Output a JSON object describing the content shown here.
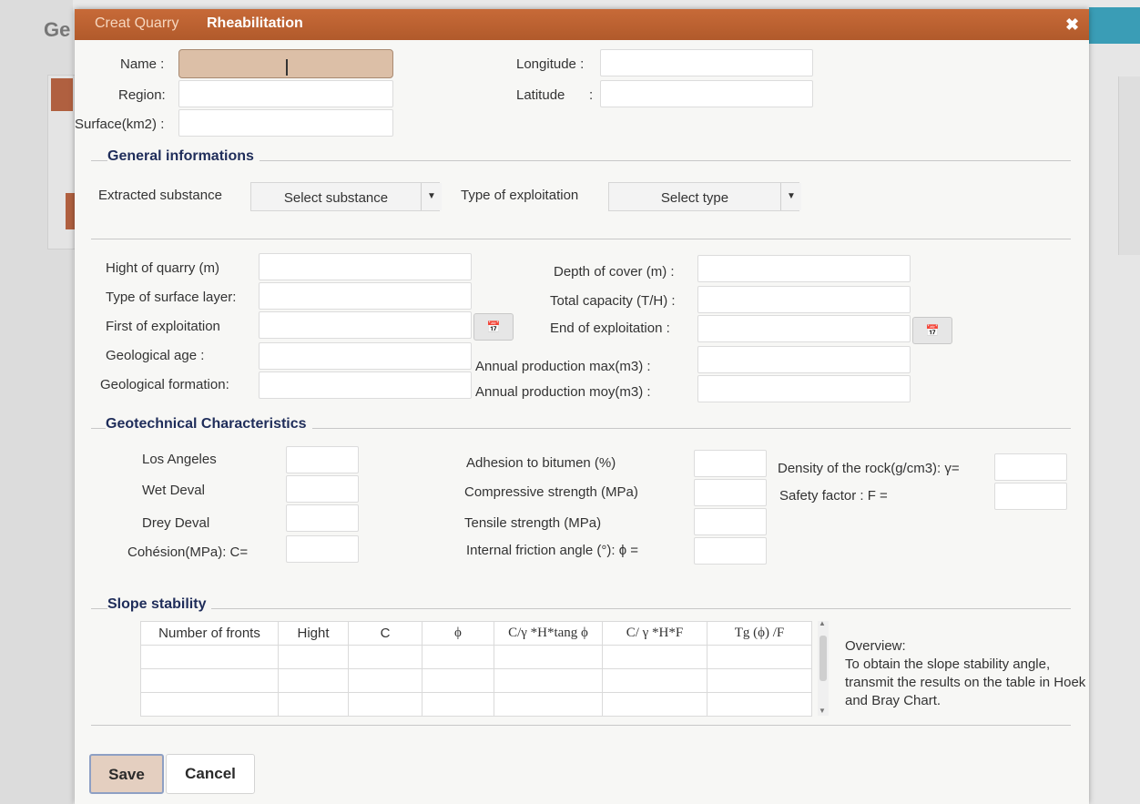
{
  "background": {
    "title": "Ge"
  },
  "dialog": {
    "tabs": {
      "creat": "Creat Quarry",
      "rheabilitation": "Rheabilitation"
    },
    "close_icon": "✖"
  },
  "identity": {
    "name_label": "Name :",
    "region_label": "Region:",
    "surface_label": "Surface(km2) :",
    "longitude_label": "Longitude :",
    "latitude_label": "Latitude",
    "latitude_colon": ":"
  },
  "general": {
    "title": "General informations",
    "extracted_label": "Extracted substance",
    "substance_select": "Select substance",
    "exploitation_label": "Type of exploitation",
    "type_select": "Select type"
  },
  "details": {
    "hight_label": "Hight of quarry (m)",
    "hight_colon": ":",
    "surface_layer_label": "Type of surface layer:",
    "first_label": "First of exploitation",
    "first_colon": ":",
    "geo_age_label": "Geological age :",
    "geo_form_label": "Geological formation:",
    "depth_label": "Depth of cover (m) :",
    "capacity_label": "Total capacity (T/H) :",
    "end_label": "End of exploitation :",
    "annual_max_label": "Annual production max(m3) :",
    "annual_moy_label": "Annual production moy(m3) :",
    "calendar_icon_1": "📅",
    "calendar_icon_2": "📅"
  },
  "geotech": {
    "title": "Geotechnical Characteristics",
    "los_angeles": "Los Angeles",
    "wet_deval": "Wet Deval",
    "drey_deval": "Drey Deval",
    "cohesion": "Cohésion(MPa): C=",
    "adhesion": "Adhesion to bitumen (%)",
    "compressive": "Compressive strength (MPa)",
    "tensile": "Tensile strength (MPa)",
    "friction": "Internal friction angle (°): ϕ =",
    "density": "Density of the rock(g/cm3): γ=",
    "safety": "Safety factor : F ="
  },
  "slope": {
    "title": "Slope stability",
    "columns": [
      "Number of fronts",
      "Hight",
      "C",
      "ϕ",
      "C/γ *H*tang ϕ",
      "C/ γ *H*F",
      "Tg (ϕ) /F"
    ],
    "overview_title": "Overview:",
    "overview_text": "To obtain the slope stability angle, transmit  the results on the table in Hoek and Bray Chart."
  },
  "buttons": {
    "save": "Save",
    "cancel": "Cancel"
  }
}
